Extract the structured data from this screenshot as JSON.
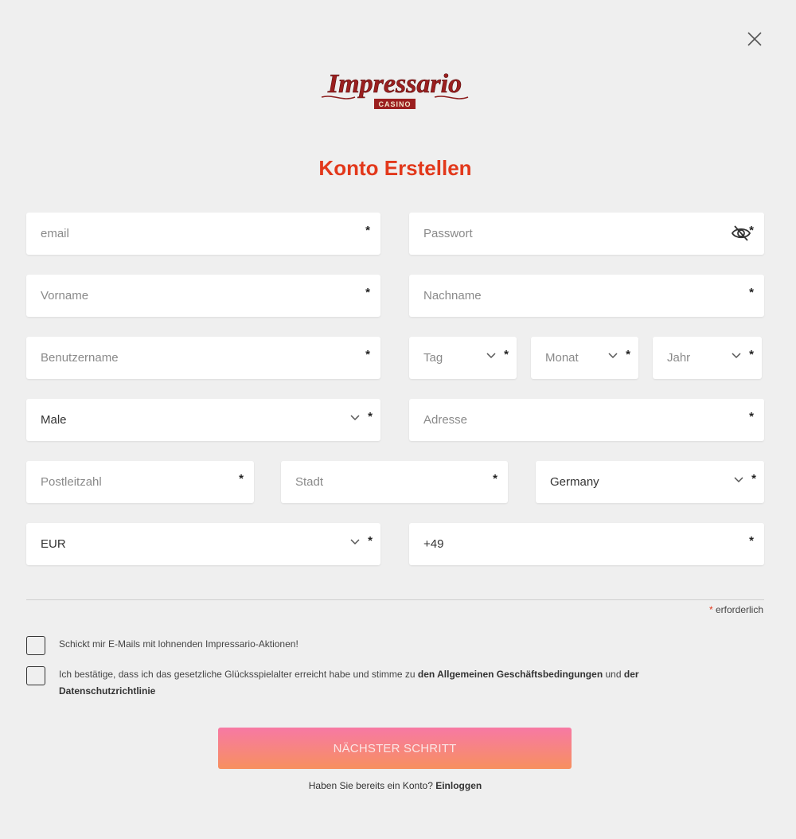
{
  "title": "Konto Erstellen",
  "logo": {
    "main": "Impressario",
    "sub": "CASINO"
  },
  "fields": {
    "email": {
      "placeholder": "email"
    },
    "password": {
      "placeholder": "Passwort"
    },
    "first_name": {
      "placeholder": "Vorname"
    },
    "last_name": {
      "placeholder": "Nachname"
    },
    "username": {
      "placeholder": "Benutzername"
    },
    "day": {
      "placeholder": "Tag"
    },
    "month": {
      "placeholder": "Monat"
    },
    "year": {
      "placeholder": "Jahr"
    },
    "gender": {
      "value": "Male"
    },
    "address": {
      "placeholder": "Adresse"
    },
    "postal_code": {
      "placeholder": "Postleitzahl"
    },
    "city": {
      "placeholder": "Stadt"
    },
    "country": {
      "value": "Germany"
    },
    "currency": {
      "value": "EUR"
    },
    "phone": {
      "value": "+49"
    }
  },
  "required_marker": "*",
  "required_note": "erforderlich",
  "checkboxes": {
    "promo": {
      "label": "Schickt mir E-Mails mit lohnenden Impressario-Aktionen!"
    },
    "terms": {
      "text_before": "Ich bestätige, dass ich das gesetzliche Glücksspielalter erreicht habe und stimme zu ",
      "link_terms": "den Allgemeinen Geschäftsbedingungen",
      "text_and": " und ",
      "link_privacy_a": "der",
      "link_privacy_b": "Datenschutzrichtlinie"
    }
  },
  "next_button": "NÄCHSTER SCHRITT",
  "login": {
    "prompt": "Haben Sie bereits ein Konto? ",
    "link": "Einloggen"
  },
  "colors": {
    "accent": "#e2381b",
    "button_top": "#f779a4",
    "button_bottom": "#f7905f",
    "background": "#efefef"
  }
}
